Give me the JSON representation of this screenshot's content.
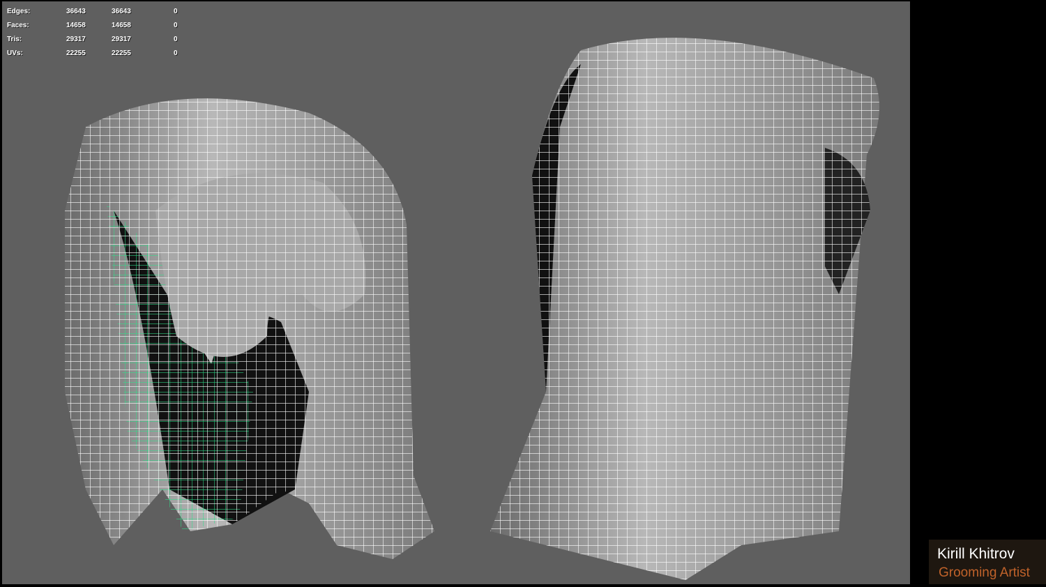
{
  "hud": {
    "rows": [
      {
        "label": "Edges:",
        "a": "36643",
        "b": "36643",
        "c": "0"
      },
      {
        "label": "Faces:",
        "a": "14658",
        "b": "14658",
        "c": "0"
      },
      {
        "label": "Tris:",
        "a": "29317",
        "b": "29317",
        "c": "0"
      },
      {
        "label": "UVs:",
        "a": "22255",
        "b": "22255",
        "c": "0"
      }
    ]
  },
  "badge": {
    "name": "Kirill Khitrov",
    "role": "Grooming Artist"
  },
  "colors": {
    "viewport": "#5f5f5f",
    "wire": "#ffffff",
    "selected_wire": "#2ee08a",
    "role": "#c0622a"
  }
}
